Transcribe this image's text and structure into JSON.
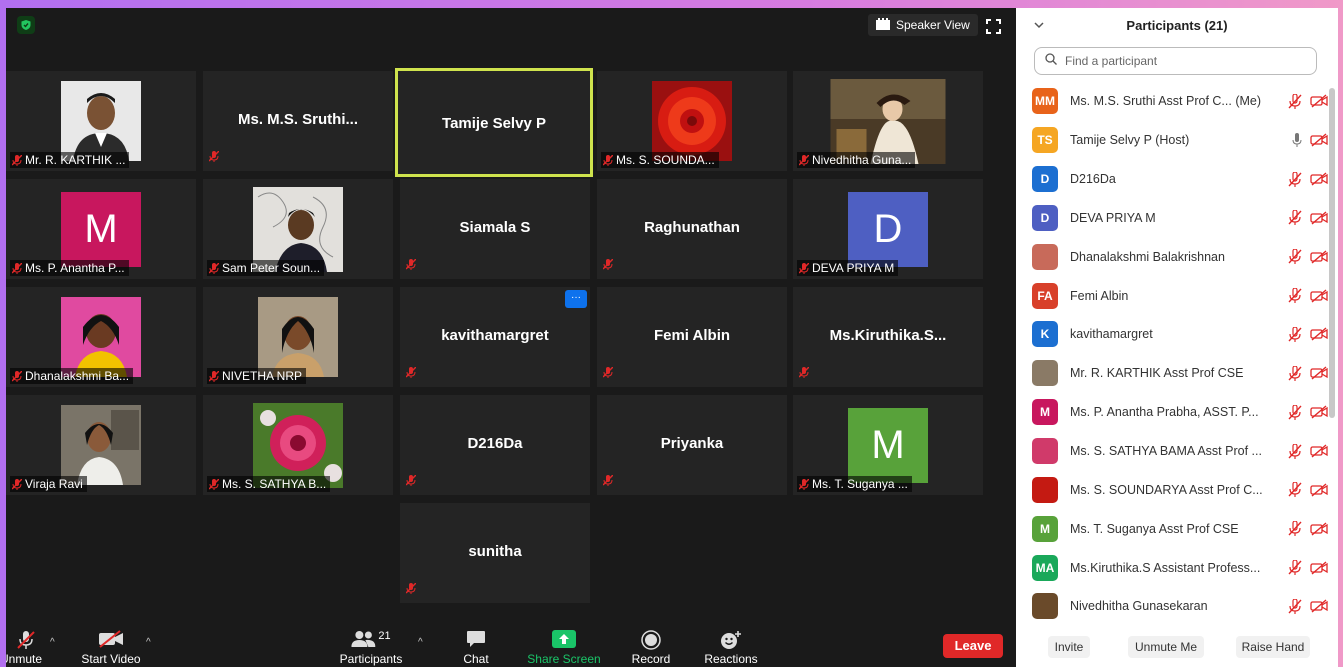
{
  "colors": {
    "accent_active": "#cfe34d",
    "leave": "#e02828",
    "share": "#1ac468",
    "muted": "#e02828",
    "link": "#0e72ed"
  },
  "top": {
    "speaker_view": "Speaker View"
  },
  "tiles": {
    "t1": "Mr. R. KARTHIK ...",
    "t2": "Ms.  M.S. Sruthi...",
    "t3": "Tamije Selvy P",
    "t4": "Ms. S. SOUNDA...",
    "t5": "Nivedhitha Guna...",
    "t6": "Ms. P. Anantha P...",
    "t6_initial": "M",
    "t7": "Sam Peter Soun...",
    "t8": "Siamala S",
    "t9": "Raghunathan",
    "t10": "DEVA PRIYA M",
    "t10_initial": "D",
    "t11": "Dhanalakshmi Ba...",
    "t12": "NIVETHA NRP",
    "t13": "kavithamargret",
    "t13_more": "···",
    "t14": "Femi Albin",
    "t15": "Ms.Kiruthika.S...",
    "t16": "Viraja Ravi",
    "t17": "Ms. S. SATHYA B...",
    "t18": "D216Da",
    "t19": "Priyanka",
    "t20": "Ms. T. Suganya ...",
    "t20_initial": "M",
    "t21": "sunitha"
  },
  "toolbar": {
    "unmute": "Unmute",
    "start_video": "Start Video",
    "participants": "Participants",
    "participants_count": "21",
    "chat": "Chat",
    "share_screen": "Share Screen",
    "record": "Record",
    "reactions": "Reactions",
    "leave": "Leave"
  },
  "panel": {
    "title": "Participants (21)",
    "search_placeholder": "Find a participant",
    "participants": [
      {
        "initials": "MM",
        "name": "Ms. M.S. Sruthi Asst Prof C... (Me)",
        "color": "#e8631a"
      },
      {
        "initials": "TS",
        "name": "Tamije Selvy P (Host)",
        "color": "#f5a623"
      },
      {
        "initials": "D",
        "name": "D216Da",
        "color": "#1c6fd1"
      },
      {
        "initials": "D",
        "name": "DEVA PRIYA M",
        "color": "#4e5fc2"
      },
      {
        "initials": "",
        "name": "Dhanalakshmi Balakrishnan",
        "color": "#c86a5a"
      },
      {
        "initials": "FA",
        "name": "Femi Albin",
        "color": "#d8402a"
      },
      {
        "initials": "K",
        "name": "kavithamargret",
        "color": "#1c6fd1"
      },
      {
        "initials": "",
        "name": "Mr. R. KARTHIK Asst Prof CSE",
        "color": "#8a7a66"
      },
      {
        "initials": "M",
        "name": "Ms. P. Anantha Prabha, ASST. P...",
        "color": "#c8175e"
      },
      {
        "initials": "",
        "name": "Ms. S. SATHYA BAMA Asst Prof ...",
        "color": "#d03a6a"
      },
      {
        "initials": "",
        "name": "Ms. S. SOUNDARYA Asst Prof C...",
        "color": "#c41a12"
      },
      {
        "initials": "M",
        "name": "Ms. T. Suganya Asst Prof CSE",
        "color": "#58a23a"
      },
      {
        "initials": "MA",
        "name": "Ms.Kiruthika.S Assistant Profess...",
        "color": "#1aa85a"
      },
      {
        "initials": "",
        "name": "Nivedhitha Gunasekaran",
        "color": "#6a4a2a"
      }
    ],
    "invite": "Invite",
    "unmute_me": "Unmute Me",
    "raise_hand": "Raise Hand"
  }
}
